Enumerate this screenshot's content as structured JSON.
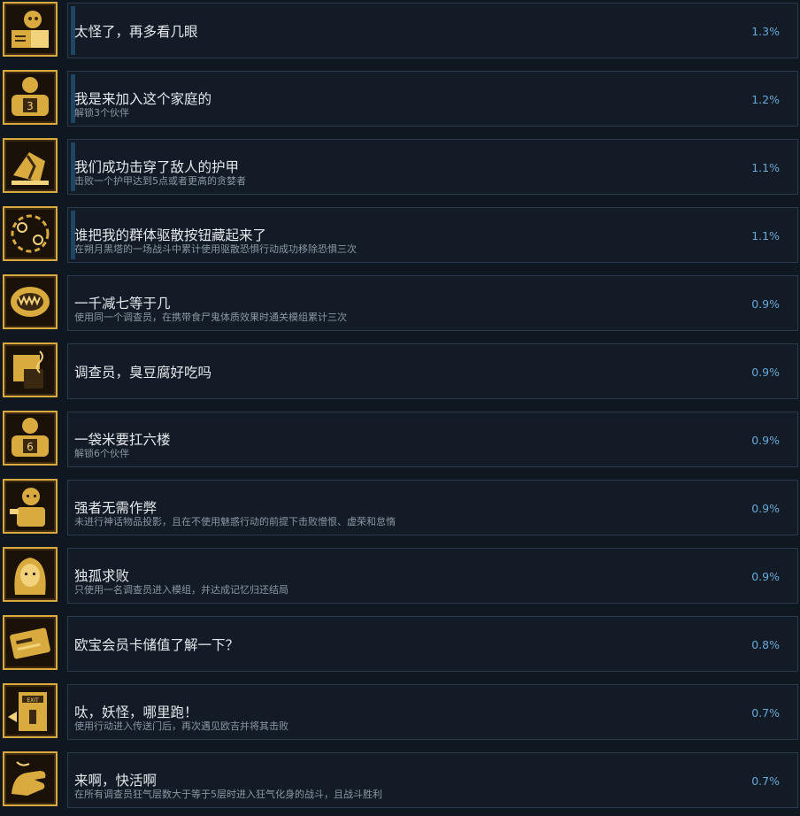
{
  "colors": {
    "background": "#0f1721",
    "card": "#121b26",
    "card_border": "#2b3a4a",
    "icon_gold": "#d9aa3d",
    "icon_dark": "#1a1208",
    "title": "#e6e9ec",
    "description": "#8b97a3",
    "percentage": "#67a8d8",
    "progress_marker": "#1d4565"
  },
  "achievements": [
    {
      "icon": "reading-book-icon",
      "title": "太怪了，再多看几眼",
      "description": "",
      "percentage": "1.3%",
      "progress": true
    },
    {
      "icon": "companion-3-icon",
      "title": "我是来加入这个家庭的",
      "description": "解锁3个伙伴",
      "percentage": "1.2%",
      "progress": true
    },
    {
      "icon": "broken-armor-icon",
      "title": "我们成功击穿了敌人的护甲",
      "description": "击败一个护甲达到5点或者更高的贪婪者",
      "percentage": "1.1%",
      "progress": true
    },
    {
      "icon": "spiral-eyes-icon",
      "title": "谁把我的群体驱散按钮藏起来了",
      "description": "在朔月黑塔的一场战斗中累计使用驱散恐惧行动成功移除恐惧三次",
      "percentage": "1.1%",
      "progress": true
    },
    {
      "icon": "ghoul-mouth-icon",
      "title": "一千减七等于几",
      "description": "使用同一个调查员，在携带食尸鬼体质效果时通关模组累计三次",
      "percentage": "0.9%",
      "progress": false
    },
    {
      "icon": "stinky-tofu-icon",
      "title": "调查员，臭豆腐好吃吗",
      "description": "",
      "percentage": "0.9%",
      "progress": false
    },
    {
      "icon": "companion-6-icon",
      "title": "一袋米要扛六楼",
      "description": "解锁6个伙伴",
      "percentage": "0.9%",
      "progress": false
    },
    {
      "icon": "strong-figure-icon",
      "title": "强者无需作弊",
      "description": "未进行神话物品投影，且在不使用魅惑行动的前提下击败憎恨、虚荣和怠惰",
      "percentage": "0.9%",
      "progress": false
    },
    {
      "icon": "lone-hero-icon",
      "title": "独孤求败",
      "description": "只使用一名调查员进入模组，并达成记忆归还结局",
      "percentage": "0.9%",
      "progress": false
    },
    {
      "icon": "member-card-icon",
      "title": "欧宝会员卡储值了解一下？",
      "description": "",
      "percentage": "0.8%",
      "progress": false
    },
    {
      "icon": "exit-door-icon",
      "title": "呔，妖怪，哪里跑！",
      "description": "使用行动进入传送门后，再次遇见欧吉并将其击败",
      "percentage": "0.7%",
      "progress": false
    },
    {
      "icon": "ecstasy-hand-icon",
      "title": "来啊，快活啊",
      "description": "在所有调查员狂气层数大于等于5层时进入狂气化身的战斗，且战斗胜利",
      "percentage": "0.7%",
      "progress": false
    }
  ]
}
